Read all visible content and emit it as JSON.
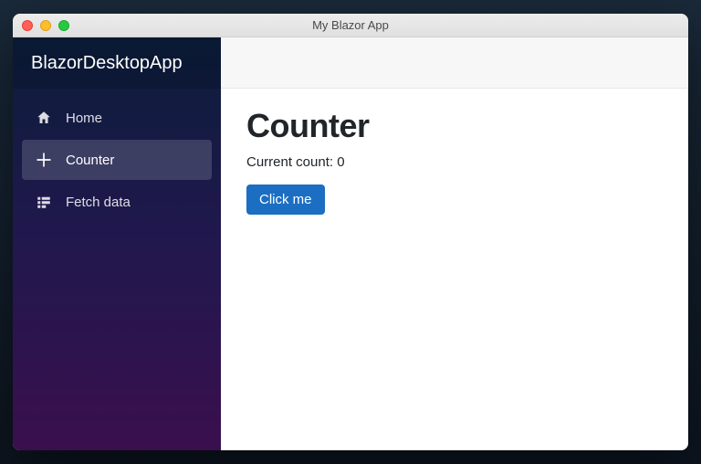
{
  "window": {
    "title": "My Blazor App"
  },
  "sidebar": {
    "app_name": "BlazorDesktopApp",
    "items": [
      {
        "label": "Home",
        "icon": "home-icon",
        "active": false
      },
      {
        "label": "Counter",
        "icon": "plus-icon",
        "active": true
      },
      {
        "label": "Fetch data",
        "icon": "list-icon",
        "active": false
      }
    ]
  },
  "main": {
    "heading": "Counter",
    "count_label": "Current count: ",
    "count_value": "0",
    "button_label": "Click me"
  }
}
